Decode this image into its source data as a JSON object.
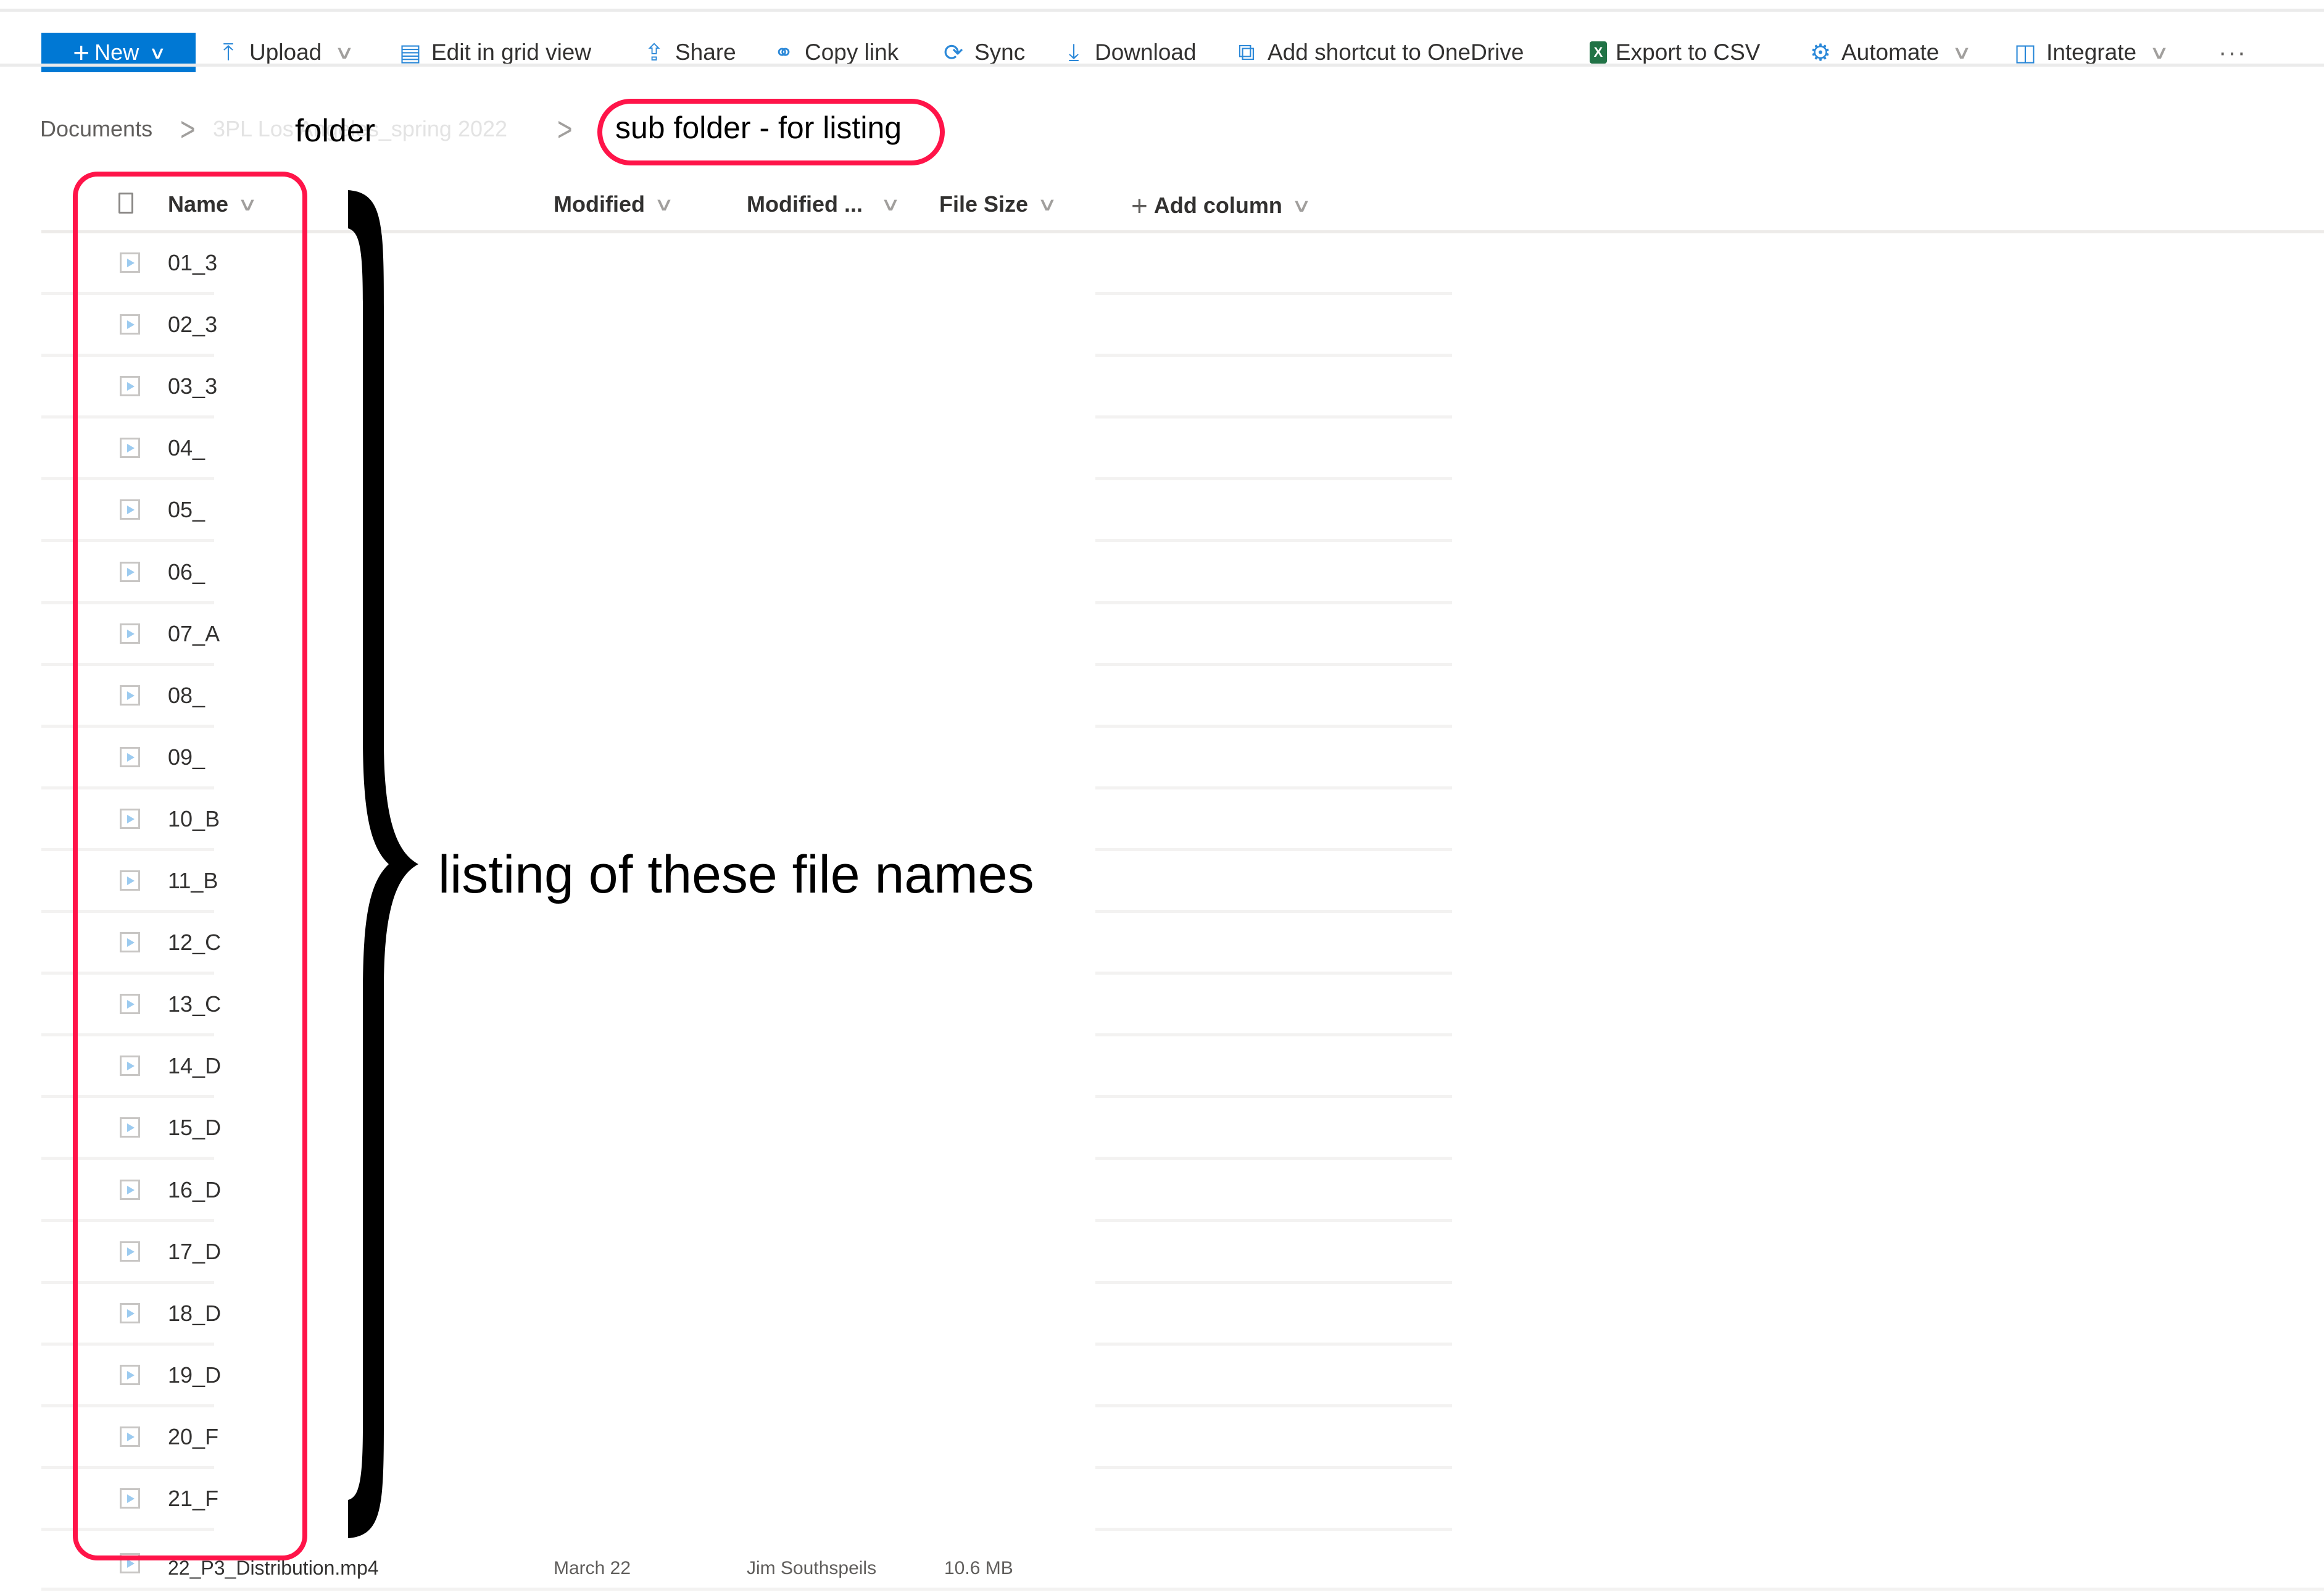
{
  "toolbar": {
    "new_label": "New",
    "items": [
      {
        "label": "Upload",
        "icon": "upload-icon",
        "glyph": "⤒",
        "has_menu": true
      },
      {
        "label": "Edit in grid view",
        "icon": "grid-view-icon",
        "glyph": "▤",
        "has_menu": false
      },
      {
        "label": "Share",
        "icon": "share-icon",
        "glyph": "⇪",
        "has_menu": false
      },
      {
        "label": "Copy link",
        "icon": "link-icon",
        "glyph": "⚭",
        "has_menu": false
      },
      {
        "label": "Sync",
        "icon": "sync-icon",
        "glyph": "⟳",
        "has_menu": false
      },
      {
        "label": "Download",
        "icon": "download-icon",
        "glyph": "⤓",
        "has_menu": false
      },
      {
        "label": "Add shortcut to OneDrive",
        "icon": "onedrive-shortcut-icon",
        "glyph": "⧉",
        "has_menu": false
      },
      {
        "label": "Export to CSV",
        "icon": "excel-icon",
        "glyph": "X",
        "has_menu": false
      },
      {
        "label": "Automate",
        "icon": "automate-icon",
        "glyph": "⚙",
        "has_menu": true
      },
      {
        "label": "Integrate",
        "icon": "integrate-icon",
        "glyph": "◫",
        "has_menu": true
      }
    ],
    "more_label": "···"
  },
  "breadcrumb": {
    "root": "Documents",
    "parent": "3PL Los Angeles_spring 2022",
    "current": "sub folder - for listing",
    "separator": ">"
  },
  "columns": {
    "name": "Name",
    "modified": "Modified",
    "modified_by": "Modified ...",
    "file_size": "File Size",
    "add_column": "Add column"
  },
  "files": [
    {
      "name": "01_3"
    },
    {
      "name": "02_3"
    },
    {
      "name": "03_3"
    },
    {
      "name": "04_"
    },
    {
      "name": "05_"
    },
    {
      "name": "06_"
    },
    {
      "name": "07_A"
    },
    {
      "name": "08_"
    },
    {
      "name": "09_"
    },
    {
      "name": "10_B"
    },
    {
      "name": "11_B"
    },
    {
      "name": "12_C"
    },
    {
      "name": "13_C"
    },
    {
      "name": "14_D"
    },
    {
      "name": "15_D"
    },
    {
      "name": "16_D"
    },
    {
      "name": "17_D"
    },
    {
      "name": "18_D"
    },
    {
      "name": "19_D"
    },
    {
      "name": "20_F"
    },
    {
      "name": "21_F"
    }
  ],
  "partial_row": {
    "name": "22_P3_Distribution.mp4",
    "modified": "March 22",
    "modified_by": "Jim Southspeils",
    "file_size": "10.6 MB"
  },
  "annotations": {
    "folder_label": "folder",
    "listing_label": "listing of these file names",
    "highlight_color": "#ff1449"
  }
}
